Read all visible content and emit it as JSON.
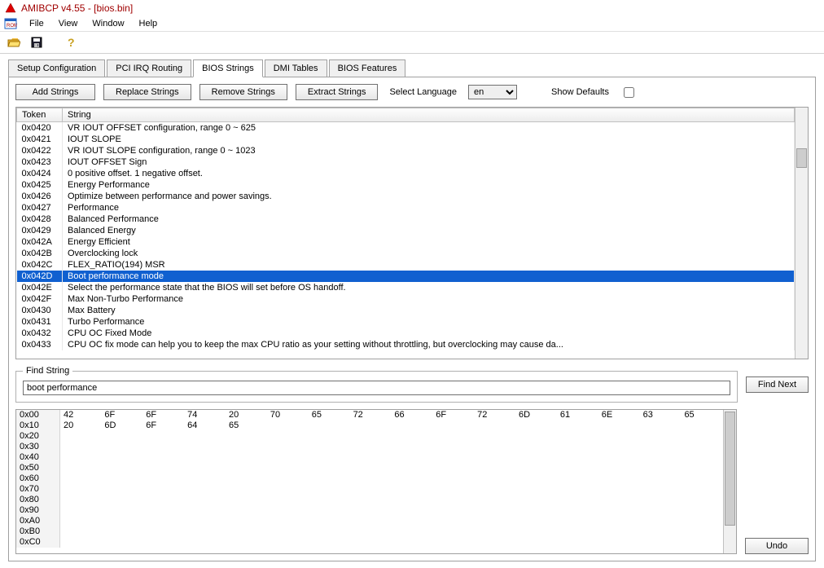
{
  "window": {
    "title": "AMIBCP v4.55 - [bios.bin]"
  },
  "menu": {
    "items": [
      "File",
      "View",
      "Window",
      "Help"
    ]
  },
  "toolbar": {
    "open_tip": "Open",
    "save_tip": "Save",
    "help_tip": "Help"
  },
  "tabs": {
    "items": [
      "Setup Configuration",
      "PCI IRQ Routing",
      "BIOS Strings",
      "DMI Tables",
      "BIOS Features"
    ],
    "active_index": 2
  },
  "buttons": {
    "add": "Add Strings",
    "replace": "Replace Strings",
    "remove": "Remove Strings",
    "extract": "Extract Strings"
  },
  "lang": {
    "label": "Select Language",
    "value": "en",
    "options": [
      "en"
    ]
  },
  "defaults": {
    "label": "Show Defaults",
    "checked": false
  },
  "grid": {
    "headers": {
      "token": "Token",
      "string": "String"
    },
    "rows": [
      {
        "token": "0x0420",
        "string": "VR IOUT OFFSET configuration, range 0 ~ 625"
      },
      {
        "token": "0x0421",
        "string": "IOUT SLOPE"
      },
      {
        "token": "0x0422",
        "string": "VR IOUT SLOPE configuration, range 0 ~ 1023"
      },
      {
        "token": "0x0423",
        "string": "IOUT OFFSET Sign"
      },
      {
        "token": "0x0424",
        "string": "0 positive offset. 1 negative offset."
      },
      {
        "token": "0x0425",
        "string": "Energy Performance"
      },
      {
        "token": "0x0426",
        "string": "Optimize between performance and power savings."
      },
      {
        "token": "0x0427",
        "string": "Performance"
      },
      {
        "token": "0x0428",
        "string": "Balanced Performance"
      },
      {
        "token": "0x0429",
        "string": "Balanced Energy"
      },
      {
        "token": "0x042A",
        "string": "Energy Efficient"
      },
      {
        "token": "0x042B",
        "string": "Overclocking lock"
      },
      {
        "token": "0x042C",
        "string": "FLEX_RATIO(194) MSR"
      },
      {
        "token": "0x042D",
        "string": "Boot performance mode",
        "selected": true
      },
      {
        "token": "0x042E",
        "string": "Select the performance state that the BIOS will set before OS handoff."
      },
      {
        "token": "0x042F",
        "string": "Max Non-Turbo Performance"
      },
      {
        "token": "0x0430",
        "string": "Max Battery"
      },
      {
        "token": "0x0431",
        "string": "Turbo Performance"
      },
      {
        "token": "0x0432",
        "string": "CPU OC Fixed Mode"
      },
      {
        "token": "0x0433",
        "string": "CPU OC fix mode can help you to keep the max CPU ratio as your setting without throttling, but overclocking may cause da..."
      }
    ]
  },
  "find": {
    "legend": "Find String",
    "value": "boot performance",
    "next": "Find Next"
  },
  "hex": {
    "addrs": [
      "0x00",
      "0x10",
      "0x20",
      "0x30",
      "0x40",
      "0x50",
      "0x60",
      "0x70",
      "0x80",
      "0x90",
      "0xA0",
      "0xB0",
      "0xC0"
    ],
    "rows": [
      [
        "42",
        "6F",
        "6F",
        "74",
        "20",
        "70",
        "65",
        "72",
        "66",
        "6F",
        "72",
        "6D",
        "61",
        "6E",
        "63",
        "65"
      ],
      [
        "20",
        "6D",
        "6F",
        "64",
        "65",
        "",
        "",
        "",
        "",
        "",
        "",
        "",
        "",
        "",
        "",
        ""
      ],
      [
        "",
        "",
        "",
        "",
        "",
        "",
        "",
        "",
        "",
        "",
        "",
        "",
        "",
        "",
        "",
        ""
      ],
      [
        "",
        "",
        "",
        "",
        "",
        "",
        "",
        "",
        "",
        "",
        "",
        "",
        "",
        "",
        "",
        ""
      ],
      [
        "",
        "",
        "",
        "",
        "",
        "",
        "",
        "",
        "",
        "",
        "",
        "",
        "",
        "",
        "",
        ""
      ],
      [
        "",
        "",
        "",
        "",
        "",
        "",
        "",
        "",
        "",
        "",
        "",
        "",
        "",
        "",
        "",
        ""
      ],
      [
        "",
        "",
        "",
        "",
        "",
        "",
        "",
        "",
        "",
        "",
        "",
        "",
        "",
        "",
        "",
        ""
      ],
      [
        "",
        "",
        "",
        "",
        "",
        "",
        "",
        "",
        "",
        "",
        "",
        "",
        "",
        "",
        "",
        ""
      ],
      [
        "",
        "",
        "",
        "",
        "",
        "",
        "",
        "",
        "",
        "",
        "",
        "",
        "",
        "",
        "",
        ""
      ],
      [
        "",
        "",
        "",
        "",
        "",
        "",
        "",
        "",
        "",
        "",
        "",
        "",
        "",
        "",
        "",
        ""
      ],
      [
        "",
        "",
        "",
        "",
        "",
        "",
        "",
        "",
        "",
        "",
        "",
        "",
        "",
        "",
        "",
        ""
      ],
      [
        "",
        "",
        "",
        "",
        "",
        "",
        "",
        "",
        "",
        "",
        "",
        "",
        "",
        "",
        "",
        ""
      ],
      [
        "",
        "",
        "",
        "",
        "",
        "",
        "",
        "",
        "",
        "",
        "",
        "",
        "",
        "",
        "",
        ""
      ]
    ]
  },
  "undo": {
    "label": "Undo"
  }
}
